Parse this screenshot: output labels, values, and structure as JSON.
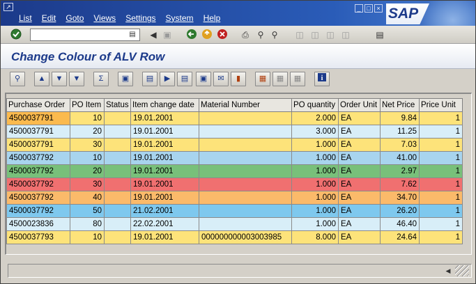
{
  "menu": {
    "items": [
      {
        "label": "List"
      },
      {
        "label": "Edit"
      },
      {
        "label": "Goto"
      },
      {
        "label": "Views"
      },
      {
        "label": "Settings"
      },
      {
        "label": "System"
      },
      {
        "label": "Help"
      }
    ]
  },
  "branding": {
    "logo_text": "SAP"
  },
  "command_field": {
    "value": ""
  },
  "page": {
    "title": "Change Colour of ALV Row"
  },
  "grid": {
    "columns": [
      {
        "label": "Purchase Order"
      },
      {
        "label": "PO Item"
      },
      {
        "label": "Status"
      },
      {
        "label": "Item change date"
      },
      {
        "label": "Material Number"
      },
      {
        "label": "PO quantity"
      },
      {
        "label": "Order Unit"
      },
      {
        "label": "Net Price"
      },
      {
        "label": "Price Unit"
      }
    ],
    "rows": [
      {
        "color": "#fde37a",
        "first_color": "#fbba4e",
        "cells": [
          "4500037791",
          "10",
          "",
          "19.01.2001",
          "",
          "2.000",
          "EA",
          "9.84",
          "1"
        ]
      },
      {
        "color": "#d8eef8",
        "first_color": "#d8eef8",
        "cells": [
          "4500037791",
          "20",
          "",
          "19.01.2001",
          "",
          "3.000",
          "EA",
          "11.25",
          "1"
        ]
      },
      {
        "color": "#fde37a",
        "first_color": "#fde37a",
        "cells": [
          "4500037791",
          "30",
          "",
          "19.01.2001",
          "",
          "1.000",
          "EA",
          "7.03",
          "1"
        ]
      },
      {
        "color": "#a8d4ee",
        "first_color": "#a8d4ee",
        "cells": [
          "4500037792",
          "10",
          "",
          "19.01.2001",
          "",
          "1.000",
          "EA",
          "41.00",
          "1"
        ]
      },
      {
        "color": "#78c07a",
        "first_color": "#78c07a",
        "cells": [
          "4500037792",
          "20",
          "",
          "19.01.2001",
          "",
          "1.000",
          "EA",
          "2.97",
          "1"
        ]
      },
      {
        "color": "#f07070",
        "first_color": "#f07070",
        "cells": [
          "4500037792",
          "30",
          "",
          "19.01.2001",
          "",
          "1.000",
          "EA",
          "7.62",
          "1"
        ]
      },
      {
        "color": "#fbba6a",
        "first_color": "#fbba6a",
        "cells": [
          "4500037792",
          "40",
          "",
          "19.01.2001",
          "",
          "1.000",
          "EA",
          "34.70",
          "1"
        ]
      },
      {
        "color": "#7ec8ee",
        "first_color": "#7ec8ee",
        "cells": [
          "4500037792",
          "50",
          "",
          "21.02.2001",
          "",
          "1.000",
          "EA",
          "26.20",
          "1"
        ]
      },
      {
        "color": "#d8eef8",
        "first_color": "#d8eef8",
        "cells": [
          "4500023836",
          "80",
          "",
          "22.02.2001",
          "",
          "1.000",
          "EA",
          "46.40",
          "1"
        ]
      },
      {
        "color": "#fde37a",
        "first_color": "#fde37a",
        "cells": [
          "4500037793",
          "10",
          "",
          "19.01.2001",
          "000000000003003985",
          "8.000",
          "EA",
          "24.64",
          "1"
        ]
      }
    ]
  },
  "icons": {
    "standard": [
      "enter-icon",
      "command-history-icon",
      "back-arrow-icon",
      "save-icon",
      "back-icon",
      "exit-icon",
      "cancel-icon",
      "print-icon",
      "find-icon",
      "find-next-icon",
      "first-page-icon",
      "previous-page-icon",
      "next-page-icon",
      "last-page-icon",
      "layout-icon"
    ],
    "application": [
      "details-icon",
      "sort-ascending-icon",
      "sort-descending-icon",
      "filter-icon",
      "total-icon",
      "subtotal-icon",
      "print-preview-icon",
      "export-icon",
      "word-processing-icon",
      "local-file-icon",
      "mail-icon",
      "graphic-icon",
      "change-layout-icon",
      "select-layout-icon",
      "save-layout-icon",
      "information-icon"
    ]
  }
}
